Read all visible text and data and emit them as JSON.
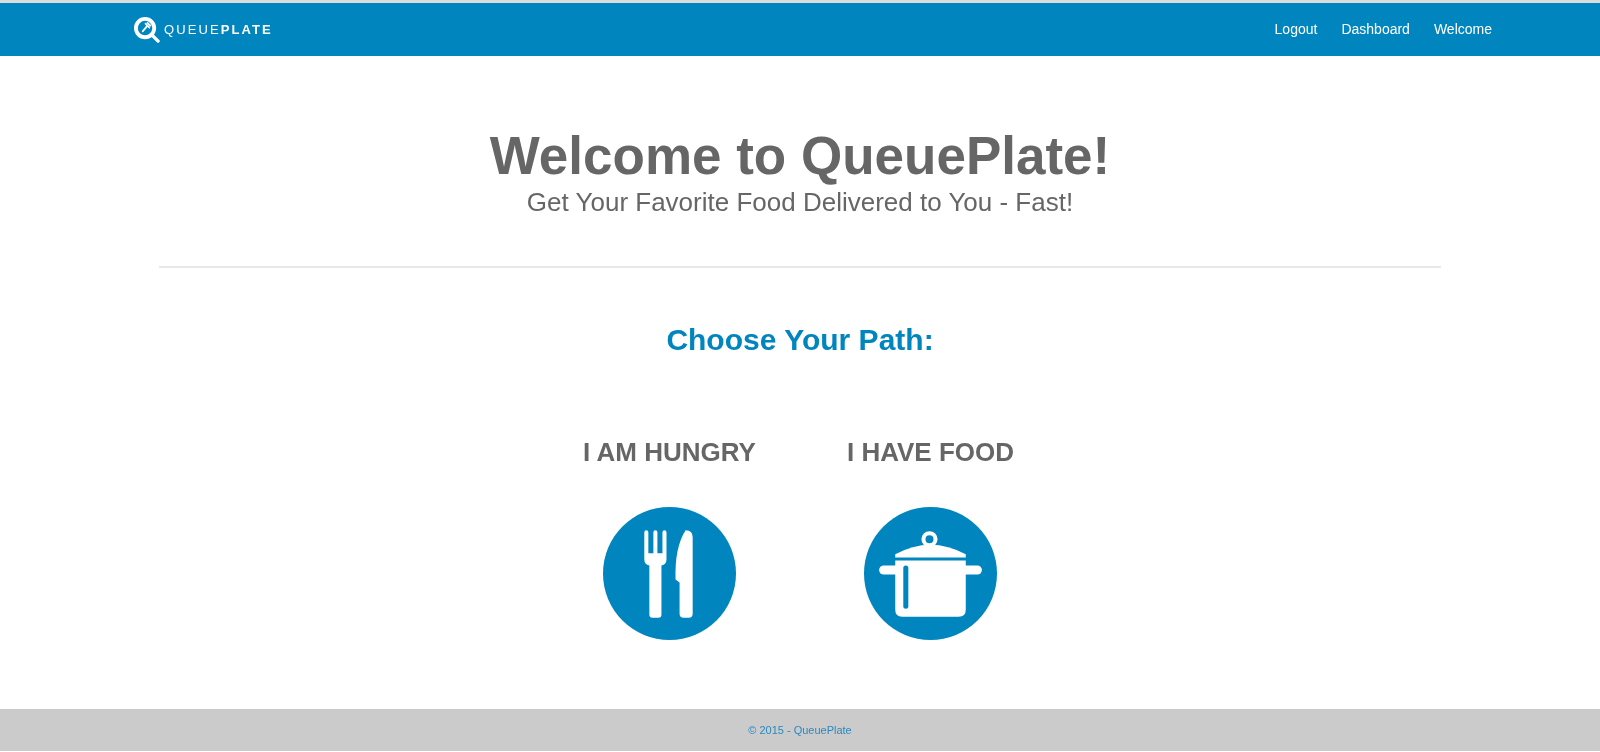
{
  "navbar": {
    "logo_text": "QUEUE**PLATE**",
    "links": [
      "Logout",
      "Dashboard",
      "Welcome"
    ]
  },
  "hero": {
    "title": "Welcome to QueuePlate!",
    "subtitle": "Get Your Favorite Food Delivered to You - Fast!"
  },
  "path_section": {
    "heading": "Choose Your Path:",
    "options": [
      {
        "label": "I AM HUNGRY",
        "kind": "cutlery"
      },
      {
        "label": "I HAVE FOOD",
        "kind": "pot"
      }
    ]
  },
  "footer": {
    "text": "© 2015 - QueuePlate"
  }
}
